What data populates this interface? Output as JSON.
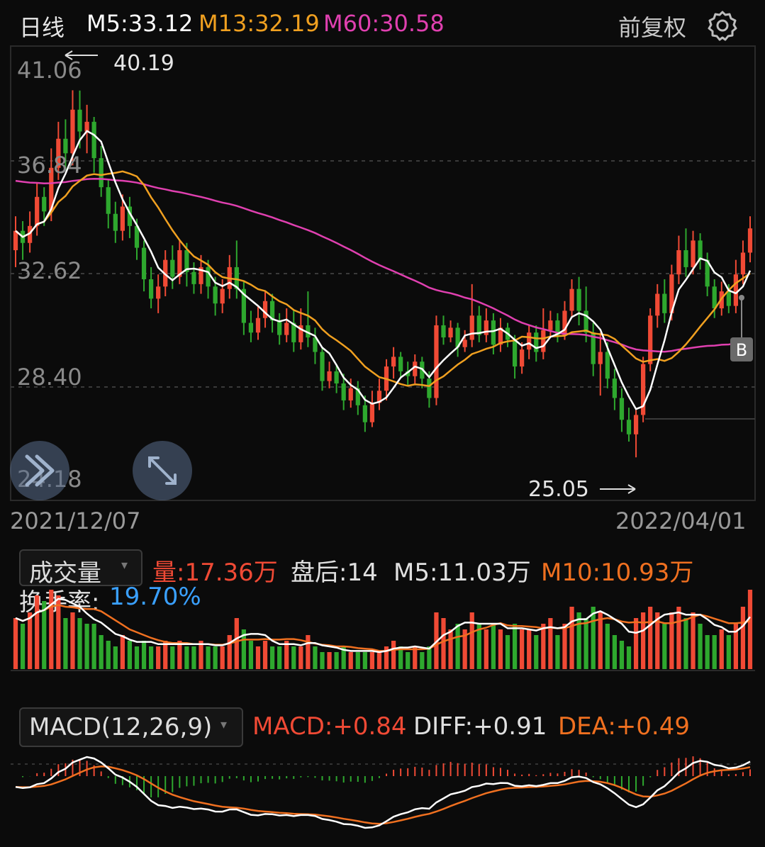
{
  "header": {
    "period": "日线",
    "ma5": "M5:33.12",
    "ma13": "M13:32.19",
    "ma60": "M60:30.58",
    "adjust": "前复权",
    "settings_icon": "gear-icon"
  },
  "colors": {
    "up": "#f04a35",
    "down": "#2ea82e",
    "ma5": "#ffffff",
    "ma13": "#f0a020",
    "ma60": "#e040b0",
    "diff": "#ffffff",
    "dea": "#f07020",
    "turnover": "#3aa0ff"
  },
  "price_chart": {
    "y_labels": [
      "41.06",
      "36.84",
      "32.62",
      "28.40",
      "24.18"
    ],
    "high_marker": "40.19",
    "low_marker": "25.05",
    "buy_badge": "B",
    "start_date": "2021/12/07",
    "end_date": "2022/04/01",
    "collapse_icon": "double-chevron-icon",
    "expand_icon": "expand-arrows-icon"
  },
  "volume_panel": {
    "selector": "成交量",
    "volume": "量:17.36万",
    "after_hours": "盘后:14",
    "m5": "M5:11.03万",
    "m10": "M10:10.93万",
    "turnover_label": "换手率:",
    "turnover_value": "19.70%"
  },
  "macd_panel": {
    "selector": "MACD(12,26,9)",
    "macd": "MACD:+0.84",
    "diff": "DIFF:+0.91",
    "dea": "DEA:+0.49"
  },
  "chart_data": {
    "type": "candlestick",
    "x_start": "2021/12/07",
    "x_end": "2022/04/01",
    "ylim": [
      24.18,
      41.06
    ],
    "candles": [
      [
        33.6,
        34.4,
        32.9,
        35.0
      ],
      [
        34.4,
        33.9,
        33.2,
        34.8
      ],
      [
        33.9,
        34.6,
        33.5,
        35.2
      ],
      [
        34.6,
        35.8,
        34.2,
        36.4
      ],
      [
        35.8,
        35.2,
        34.6,
        36.2
      ],
      [
        35.2,
        37.0,
        34.8,
        37.8
      ],
      [
        37.0,
        38.2,
        36.5,
        38.9
      ],
      [
        38.2,
        37.6,
        36.9,
        39.0
      ],
      [
        37.6,
        39.4,
        37.1,
        40.2
      ],
      [
        39.4,
        38.5,
        37.8,
        40.19
      ],
      [
        38.5,
        38.9,
        37.6,
        39.6
      ],
      [
        38.9,
        37.4,
        36.8,
        39.1
      ],
      [
        37.4,
        36.2,
        35.8,
        37.9
      ],
      [
        36.2,
        35.1,
        34.5,
        36.5
      ],
      [
        35.1,
        34.4,
        33.9,
        35.6
      ],
      [
        34.4,
        35.4,
        34.0,
        35.9
      ],
      [
        35.4,
        34.6,
        34.1,
        35.8
      ],
      [
        34.6,
        33.7,
        33.2,
        34.9
      ],
      [
        33.7,
        32.4,
        31.9,
        34.0
      ],
      [
        32.4,
        31.6,
        31.2,
        32.9
      ],
      [
        31.6,
        32.1,
        31.0,
        32.6
      ],
      [
        32.1,
        33.2,
        31.7,
        33.6
      ],
      [
        33.2,
        32.5,
        32.0,
        33.8
      ],
      [
        32.5,
        33.6,
        32.2,
        34.0
      ],
      [
        33.6,
        32.7,
        32.1,
        33.9
      ],
      [
        32.7,
        32.2,
        31.8,
        33.1
      ],
      [
        32.2,
        32.9,
        31.8,
        33.4
      ],
      [
        32.9,
        32.1,
        31.6,
        33.2
      ],
      [
        32.1,
        31.4,
        30.9,
        32.5
      ],
      [
        31.4,
        32.0,
        31.0,
        32.4
      ],
      [
        32.0,
        32.9,
        31.6,
        33.4
      ],
      [
        32.9,
        32.0,
        31.6,
        34.0
      ],
      [
        32.0,
        30.6,
        30.1,
        32.3
      ],
      [
        30.6,
        30.2,
        29.8,
        31.1
      ],
      [
        30.2,
        30.8,
        29.9,
        31.3
      ],
      [
        30.8,
        31.5,
        30.4,
        31.9
      ],
      [
        31.5,
        30.7,
        30.2,
        31.8
      ],
      [
        30.7,
        30.1,
        29.7,
        31.0
      ],
      [
        30.1,
        30.6,
        29.8,
        31.2
      ],
      [
        30.6,
        29.8,
        29.4,
        31.1
      ],
      [
        29.8,
        30.5,
        29.5,
        31.2
      ],
      [
        30.5,
        30.0,
        29.6,
        31.9
      ],
      [
        30.0,
        29.4,
        28.9,
        30.4
      ],
      [
        29.4,
        28.2,
        27.8,
        29.6
      ],
      [
        28.2,
        28.6,
        27.9,
        29.0
      ],
      [
        28.6,
        28.1,
        27.7,
        28.9
      ],
      [
        28.1,
        27.4,
        27.0,
        28.5
      ],
      [
        27.4,
        27.9,
        27.1,
        28.3
      ],
      [
        27.9,
        27.2,
        26.8,
        28.2
      ],
      [
        27.2,
        26.5,
        26.1,
        27.6
      ],
      [
        26.5,
        27.3,
        26.3,
        27.8
      ],
      [
        27.3,
        27.8,
        27.0,
        28.3
      ],
      [
        27.8,
        28.8,
        27.4,
        29.1
      ],
      [
        28.8,
        29.2,
        28.3,
        29.6
      ],
      [
        29.2,
        28.6,
        28.3,
        29.4
      ],
      [
        28.6,
        28.4,
        28.0,
        29.0
      ],
      [
        28.4,
        29.0,
        28.1,
        29.3
      ],
      [
        29.0,
        28.3,
        27.9,
        29.2
      ],
      [
        28.3,
        27.5,
        27.1,
        28.6
      ],
      [
        27.5,
        30.5,
        27.2,
        30.9
      ],
      [
        30.5,
        30.0,
        29.7,
        30.9
      ],
      [
        30.0,
        30.4,
        29.8,
        30.7
      ],
      [
        30.4,
        29.6,
        29.2,
        30.6
      ],
      [
        29.6,
        29.9,
        29.4,
        30.3
      ],
      [
        29.9,
        30.9,
        29.6,
        32.2
      ],
      [
        30.9,
        30.1,
        29.8,
        31.3
      ],
      [
        30.1,
        30.7,
        29.8,
        31.2
      ],
      [
        30.7,
        29.7,
        29.3,
        31.0
      ],
      [
        29.7,
        30.4,
        29.4,
        30.8
      ],
      [
        30.4,
        29.9,
        29.6,
        30.6
      ],
      [
        29.9,
        28.8,
        28.3,
        30.1
      ],
      [
        28.8,
        29.5,
        28.5,
        29.8
      ],
      [
        29.5,
        30.2,
        29.1,
        30.5
      ],
      [
        30.2,
        29.4,
        29.0,
        30.5
      ],
      [
        29.4,
        30.3,
        29.1,
        31.2
      ],
      [
        30.3,
        30.7,
        30.0,
        31.1
      ],
      [
        30.7,
        30.1,
        29.8,
        31.0
      ],
      [
        30.1,
        31.1,
        29.9,
        31.5
      ],
      [
        31.1,
        32.0,
        30.8,
        32.4
      ],
      [
        32.0,
        31.1,
        30.5,
        32.5
      ],
      [
        31.1,
        30.2,
        29.8,
        32.1
      ],
      [
        30.2,
        28.9,
        28.4,
        30.6
      ],
      [
        28.9,
        29.4,
        27.6,
        30.2
      ],
      [
        29.4,
        28.3,
        27.9,
        29.8
      ],
      [
        28.3,
        27.5,
        27.0,
        28.7
      ],
      [
        27.5,
        26.6,
        26.1,
        27.9
      ],
      [
        26.6,
        26.0,
        25.7,
        27.1
      ],
      [
        26.0,
        26.8,
        25.05,
        27.0
      ],
      [
        26.8,
        28.9,
        26.5,
        29.2
      ],
      [
        28.9,
        30.9,
        28.6,
        31.2
      ],
      [
        30.9,
        31.8,
        30.4,
        32.2
      ],
      [
        31.8,
        31.0,
        30.6,
        32.4
      ],
      [
        31.0,
        32.6,
        30.7,
        33.0
      ],
      [
        32.6,
        33.6,
        32.2,
        34.2
      ],
      [
        33.6,
        32.9,
        32.5,
        34.5
      ],
      [
        32.9,
        34.0,
        32.6,
        34.4
      ],
      [
        34.0,
        33.2,
        32.8,
        34.3
      ],
      [
        33.2,
        32.1,
        31.7,
        33.5
      ],
      [
        32.1,
        31.2,
        30.8,
        32.4
      ],
      [
        31.2,
        31.9,
        30.9,
        32.3
      ],
      [
        31.9,
        31.3,
        31.0,
        32.2
      ],
      [
        31.3,
        32.6,
        31.0,
        33.2
      ],
      [
        32.6,
        33.5,
        32.2,
        34.0
      ],
      [
        33.5,
        34.5,
        33.1,
        35.0
      ]
    ],
    "volume": [
      [
        9,
        1
      ],
      [
        8,
        0
      ],
      [
        10,
        1
      ],
      [
        13,
        1
      ],
      [
        12,
        0
      ],
      [
        14,
        1
      ],
      [
        13,
        1
      ],
      [
        9,
        0
      ],
      [
        10,
        1
      ],
      [
        9,
        0
      ],
      [
        8,
        0
      ],
      [
        8,
        0
      ],
      [
        6,
        0
      ],
      [
        5,
        0
      ],
      [
        4,
        0
      ],
      [
        6,
        1
      ],
      [
        5,
        0
      ],
      [
        4,
        0
      ],
      [
        5,
        0
      ],
      [
        4,
        0
      ],
      [
        4,
        1
      ],
      [
        5,
        1
      ],
      [
        4,
        0
      ],
      [
        5,
        1
      ],
      [
        4,
        0
      ],
      [
        4,
        0
      ],
      [
        5,
        1
      ],
      [
        4,
        0
      ],
      [
        4,
        0
      ],
      [
        4,
        1
      ],
      [
        6,
        1
      ],
      [
        9,
        1
      ],
      [
        7,
        0
      ],
      [
        5,
        0
      ],
      [
        4,
        1
      ],
      [
        5,
        1
      ],
      [
        4,
        0
      ],
      [
        4,
        0
      ],
      [
        5,
        1
      ],
      [
        4,
        0
      ],
      [
        4,
        1
      ],
      [
        6,
        1
      ],
      [
        4,
        0
      ],
      [
        3,
        0
      ],
      [
        3,
        1
      ],
      [
        3,
        0
      ],
      [
        4,
        0
      ],
      [
        3,
        1
      ],
      [
        3,
        0
      ],
      [
        3,
        0
      ],
      [
        3,
        1
      ],
      [
        3,
        1
      ],
      [
        4,
        1
      ],
      [
        5,
        1
      ],
      [
        4,
        0
      ],
      [
        3,
        0
      ],
      [
        4,
        1
      ],
      [
        3,
        0
      ],
      [
        4,
        0
      ],
      [
        10,
        1
      ],
      [
        9,
        1
      ],
      [
        7,
        1
      ],
      [
        8,
        0
      ],
      [
        7,
        1
      ],
      [
        10,
        1
      ],
      [
        8,
        0
      ],
      [
        7,
        1
      ],
      [
        8,
        0
      ],
      [
        7,
        1
      ],
      [
        6,
        0
      ],
      [
        8,
        0
      ],
      [
        7,
        1
      ],
      [
        7,
        1
      ],
      [
        6,
        0
      ],
      [
        8,
        1
      ],
      [
        9,
        1
      ],
      [
        6,
        0
      ],
      [
        8,
        1
      ],
      [
        11,
        1
      ],
      [
        10,
        0
      ],
      [
        9,
        0
      ],
      [
        11,
        0
      ],
      [
        10,
        1
      ],
      [
        8,
        0
      ],
      [
        6,
        0
      ],
      [
        5,
        0
      ],
      [
        4,
        0
      ],
      [
        9,
        1
      ],
      [
        10,
        1
      ],
      [
        11,
        1
      ],
      [
        10,
        1
      ],
      [
        8,
        0
      ],
      [
        10,
        1
      ],
      [
        11,
        1
      ],
      [
        9,
        0
      ],
      [
        10,
        1
      ],
      [
        8,
        0
      ],
      [
        6,
        0
      ],
      [
        6,
        0
      ],
      [
        7,
        1
      ],
      [
        6,
        0
      ],
      [
        8,
        1
      ],
      [
        11,
        1
      ],
      [
        14,
        1
      ]
    ]
  }
}
